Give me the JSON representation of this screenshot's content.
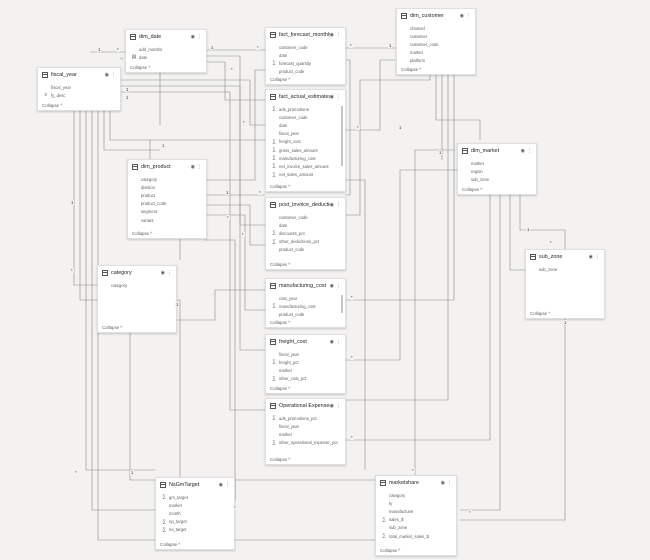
{
  "collapse_label": "Collapse ^",
  "tables": {
    "fiscal_year": {
      "title": "fiscal_year",
      "fields": [
        {
          "icon": "none",
          "name": "fiscal_year"
        },
        {
          "icon": "hierarchy",
          "name": "fy_desc"
        }
      ]
    },
    "dim_date": {
      "title": "dim_date",
      "fields": [
        {
          "icon": "none",
          "name": "add_months"
        },
        {
          "icon": "calendar",
          "name": "date"
        }
      ]
    },
    "fact_forecast_monthly": {
      "title": "fact_forecast_monthly",
      "fields": [
        {
          "icon": "none",
          "name": "customer_code"
        },
        {
          "icon": "none",
          "name": "date"
        },
        {
          "icon": "sum",
          "name": "forecast_quantity"
        },
        {
          "icon": "none",
          "name": "product_code"
        }
      ]
    },
    "dim_customer": {
      "title": "dim_customer",
      "fields": [
        {
          "icon": "none",
          "name": "channel"
        },
        {
          "icon": "none",
          "name": "customer"
        },
        {
          "icon": "none",
          "name": "customer_code"
        },
        {
          "icon": "none",
          "name": "market"
        },
        {
          "icon": "none",
          "name": "platform"
        }
      ]
    },
    "fact_actual_estimates": {
      "title": "fact_actual_estimates",
      "fields": [
        {
          "icon": "sum",
          "name": "ads_promotions"
        },
        {
          "icon": "none",
          "name": "customer_code"
        },
        {
          "icon": "none",
          "name": "date"
        },
        {
          "icon": "none",
          "name": "fiscal_year"
        },
        {
          "icon": "sum",
          "name": "freight_cost"
        },
        {
          "icon": "sum",
          "name": "gross_sales_amount"
        },
        {
          "icon": "sum",
          "name": "manufacturing_cost"
        },
        {
          "icon": "sum",
          "name": "net_invoice_sales_amount"
        },
        {
          "icon": "sum",
          "name": "net_sales_amount"
        }
      ]
    },
    "dim_market": {
      "title": "dim_market",
      "fields": [
        {
          "icon": "none",
          "name": "market"
        },
        {
          "icon": "none",
          "name": "region"
        },
        {
          "icon": "none",
          "name": "sub_zone"
        }
      ]
    },
    "dim_product": {
      "title": "dim_product",
      "fields": [
        {
          "icon": "none",
          "name": "category"
        },
        {
          "icon": "none",
          "name": "division"
        },
        {
          "icon": "none",
          "name": "product"
        },
        {
          "icon": "none",
          "name": "product_code"
        },
        {
          "icon": "none",
          "name": "segment"
        },
        {
          "icon": "none",
          "name": "variant"
        }
      ]
    },
    "post_invoice": {
      "title": "post_invoice_deductio...",
      "fields": [
        {
          "icon": "none",
          "name": "customer_code"
        },
        {
          "icon": "none",
          "name": "date"
        },
        {
          "icon": "sum",
          "name": "discounts_pct"
        },
        {
          "icon": "sum",
          "name": "other_deductions_pct"
        },
        {
          "icon": "none",
          "name": "product_code"
        }
      ]
    },
    "sub_zone": {
      "title": "sub_zone",
      "fields": [
        {
          "icon": "none",
          "name": "sub_zone"
        }
      ]
    },
    "category": {
      "title": "category",
      "fields": [
        {
          "icon": "none",
          "name": "category"
        }
      ]
    },
    "manufacturing_cost": {
      "title": "manufacturing_cost",
      "fields": [
        {
          "icon": "none",
          "name": "cost_year"
        },
        {
          "icon": "sum",
          "name": "manufacturing_cost"
        },
        {
          "icon": "none",
          "name": "product_code"
        }
      ]
    },
    "freight_cost": {
      "title": "freight_cost",
      "fields": [
        {
          "icon": "none",
          "name": "fiscal_year"
        },
        {
          "icon": "sum",
          "name": "freight_pct"
        },
        {
          "icon": "none",
          "name": "market"
        },
        {
          "icon": "sum",
          "name": "other_cost_pct"
        }
      ]
    },
    "operational_expenses": {
      "title": "Operational Expenses",
      "fields": [
        {
          "icon": "sum",
          "name": "ads_promotions_pct"
        },
        {
          "icon": "none",
          "name": "fiscal_year"
        },
        {
          "icon": "none",
          "name": "market"
        },
        {
          "icon": "sum",
          "name": "other_operational_expense_pct"
        }
      ]
    },
    "nsgm_target": {
      "title": "NsGmTarget",
      "fields": [
        {
          "icon": "sum",
          "name": "gm_target"
        },
        {
          "icon": "none",
          "name": "market"
        },
        {
          "icon": "none",
          "name": "month"
        },
        {
          "icon": "sum",
          "name": "np_target"
        },
        {
          "icon": "sum",
          "name": "ns_target"
        }
      ]
    },
    "marketshare": {
      "title": "marketshare",
      "fields": [
        {
          "icon": "none",
          "name": "category"
        },
        {
          "icon": "none",
          "name": "fy"
        },
        {
          "icon": "none",
          "name": "manufacturer"
        },
        {
          "icon": "sum",
          "name": "sales_$"
        },
        {
          "icon": "none",
          "name": "sub_zone"
        },
        {
          "icon": "sum",
          "name": "total_market_sales_$"
        }
      ]
    }
  },
  "relationship_labels": {
    "one": "1",
    "many": "*"
  }
}
